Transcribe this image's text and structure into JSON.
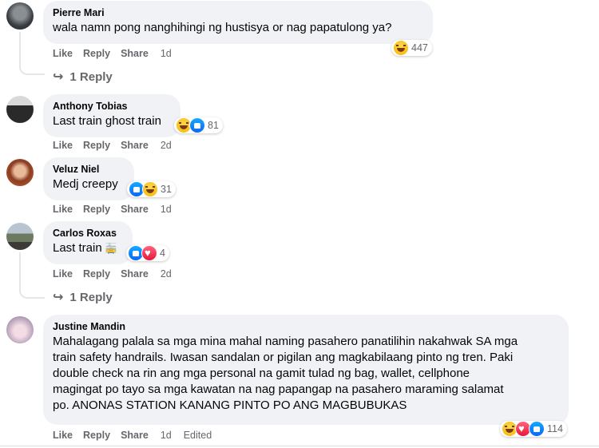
{
  "actions": {
    "like": "Like",
    "reply": "Reply",
    "share": "Share"
  },
  "comments": [
    {
      "name": "Pierre Mari",
      "text": "wala namn pong nanghihingi ng hustisya or nag papatulong ya?",
      "time": "1d",
      "reaction_count": "447",
      "reactions": [
        "haha"
      ],
      "replies_label": "1 Reply"
    },
    {
      "name": "Anthony Tobias",
      "text": "Last train ghost train",
      "time": "2d",
      "reaction_count": "81",
      "reactions": [
        "haha",
        "like"
      ]
    },
    {
      "name": "Veluz Niel",
      "text": "Medj creepy",
      "time": "1d",
      "reaction_count": "31",
      "reactions": [
        "like",
        "haha"
      ]
    },
    {
      "name": "Carlos Roxas",
      "text": "Last train",
      "time": "2d",
      "reaction_count": "4",
      "reactions": [
        "like",
        "love"
      ],
      "replies_label": "1 Reply"
    },
    {
      "name": "Justine Mandin",
      "text_lines": [
        "Mahalagang palala sa mga mina mahal naming pasahero panatilihin nakahwak SA mga",
        "train safety handrails. Iwasan sandalan or pigilan ang magkabilaang pinto ng tren. Paki",
        "double check na rin ang mga personal na gamit tulad ng bag, wallet, cellphone",
        "magingat po tayo sa mga kawatan na nag papangap na pasahero maraming salamat",
        "po. ANONAS STATION KANANG PINTO PO ANG MAGBUBUKAS"
      ],
      "time": "1d",
      "edited": "Edited",
      "reaction_count": "114",
      "reactions": [
        "haha",
        "love",
        "like"
      ]
    }
  ],
  "colors": {
    "bubble": "#f0f2f5",
    "meta": "#65676b",
    "like": "#0866ff",
    "love": "#f33e58",
    "haha": "#f7b928"
  }
}
